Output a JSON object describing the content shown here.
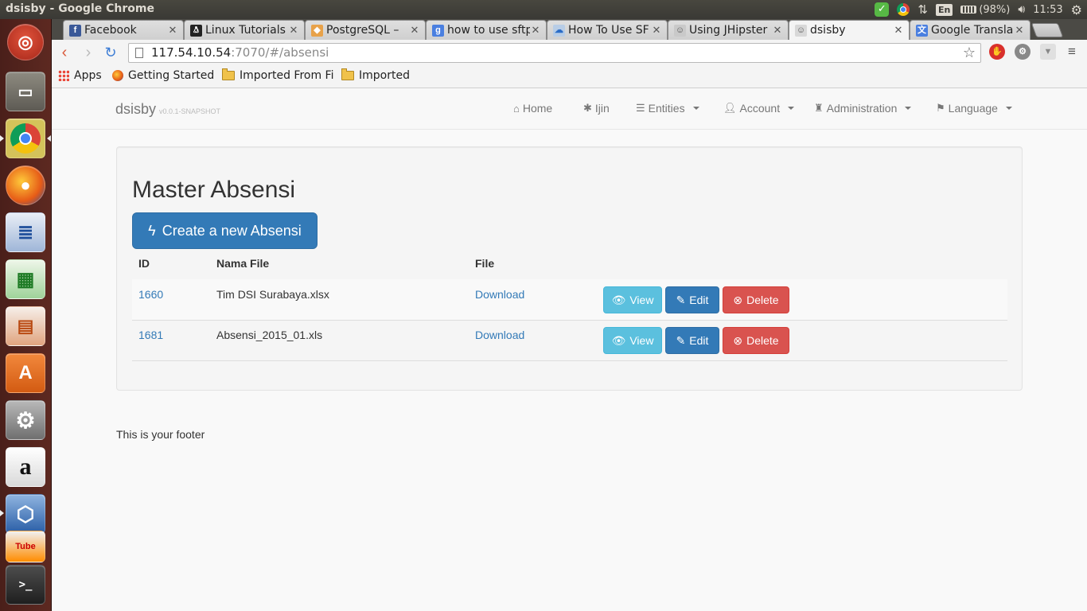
{
  "window": {
    "title": "dsisby - Google Chrome"
  },
  "indicators": {
    "input_method": "En",
    "battery": "(98%)",
    "clock": "11:53"
  },
  "launcher": {
    "items": [
      "ubuntu-dash",
      "files",
      "chrome",
      "firefox",
      "writer",
      "calc",
      "impress",
      "software-center",
      "system-settings",
      "amazon",
      "virtualbox",
      "youtube",
      "terminal"
    ]
  },
  "tabs": [
    {
      "title": "Facebook",
      "icon": "facebook-icon"
    },
    {
      "title": "Linux Tutorials",
      "icon": "tux-icon"
    },
    {
      "title": "PostgreSQL –",
      "icon": "postgresql-icon"
    },
    {
      "title": "how to use sftp",
      "icon": "google-icon"
    },
    {
      "title": "How To Use SF",
      "icon": "digitalocean-icon"
    },
    {
      "title": "Using JHipster",
      "icon": "jhipster-icon"
    },
    {
      "title": "dsisby",
      "icon": "jhipster-icon"
    },
    {
      "title": "Google Transla",
      "icon": "translate-icon"
    }
  ],
  "address": {
    "host": "117.54.10.54",
    "rest": ":7070/#/absensi"
  },
  "bookmarks": [
    "Apps",
    "Getting Started",
    "Imported From Fi",
    "Imported"
  ],
  "app": {
    "brand": "dsisby",
    "version": "v0.0.1-SNAPSHOT",
    "nav": [
      "Home",
      "Ijin",
      "Entities",
      "Account",
      "Administration",
      "Language"
    ]
  },
  "main": {
    "title": "Master Absensi",
    "create_label": "Create a new Absensi",
    "headers": [
      "ID",
      "Nama File",
      "File"
    ],
    "rows": [
      {
        "id": "1660",
        "nama_file": "Tim DSI Surabaya.xlsx",
        "file": "Download"
      },
      {
        "id": "1681",
        "nama_file": "Absensi_2015_01.xls",
        "file": "Download"
      }
    ],
    "actions": {
      "view": "View",
      "edit": "Edit",
      "delete": "Delete"
    }
  },
  "footer": "This is your footer",
  "colors": {
    "primary": "#337ab7",
    "info": "#5bc0de",
    "danger": "#d9534f",
    "launcher": "#5d2921"
  }
}
